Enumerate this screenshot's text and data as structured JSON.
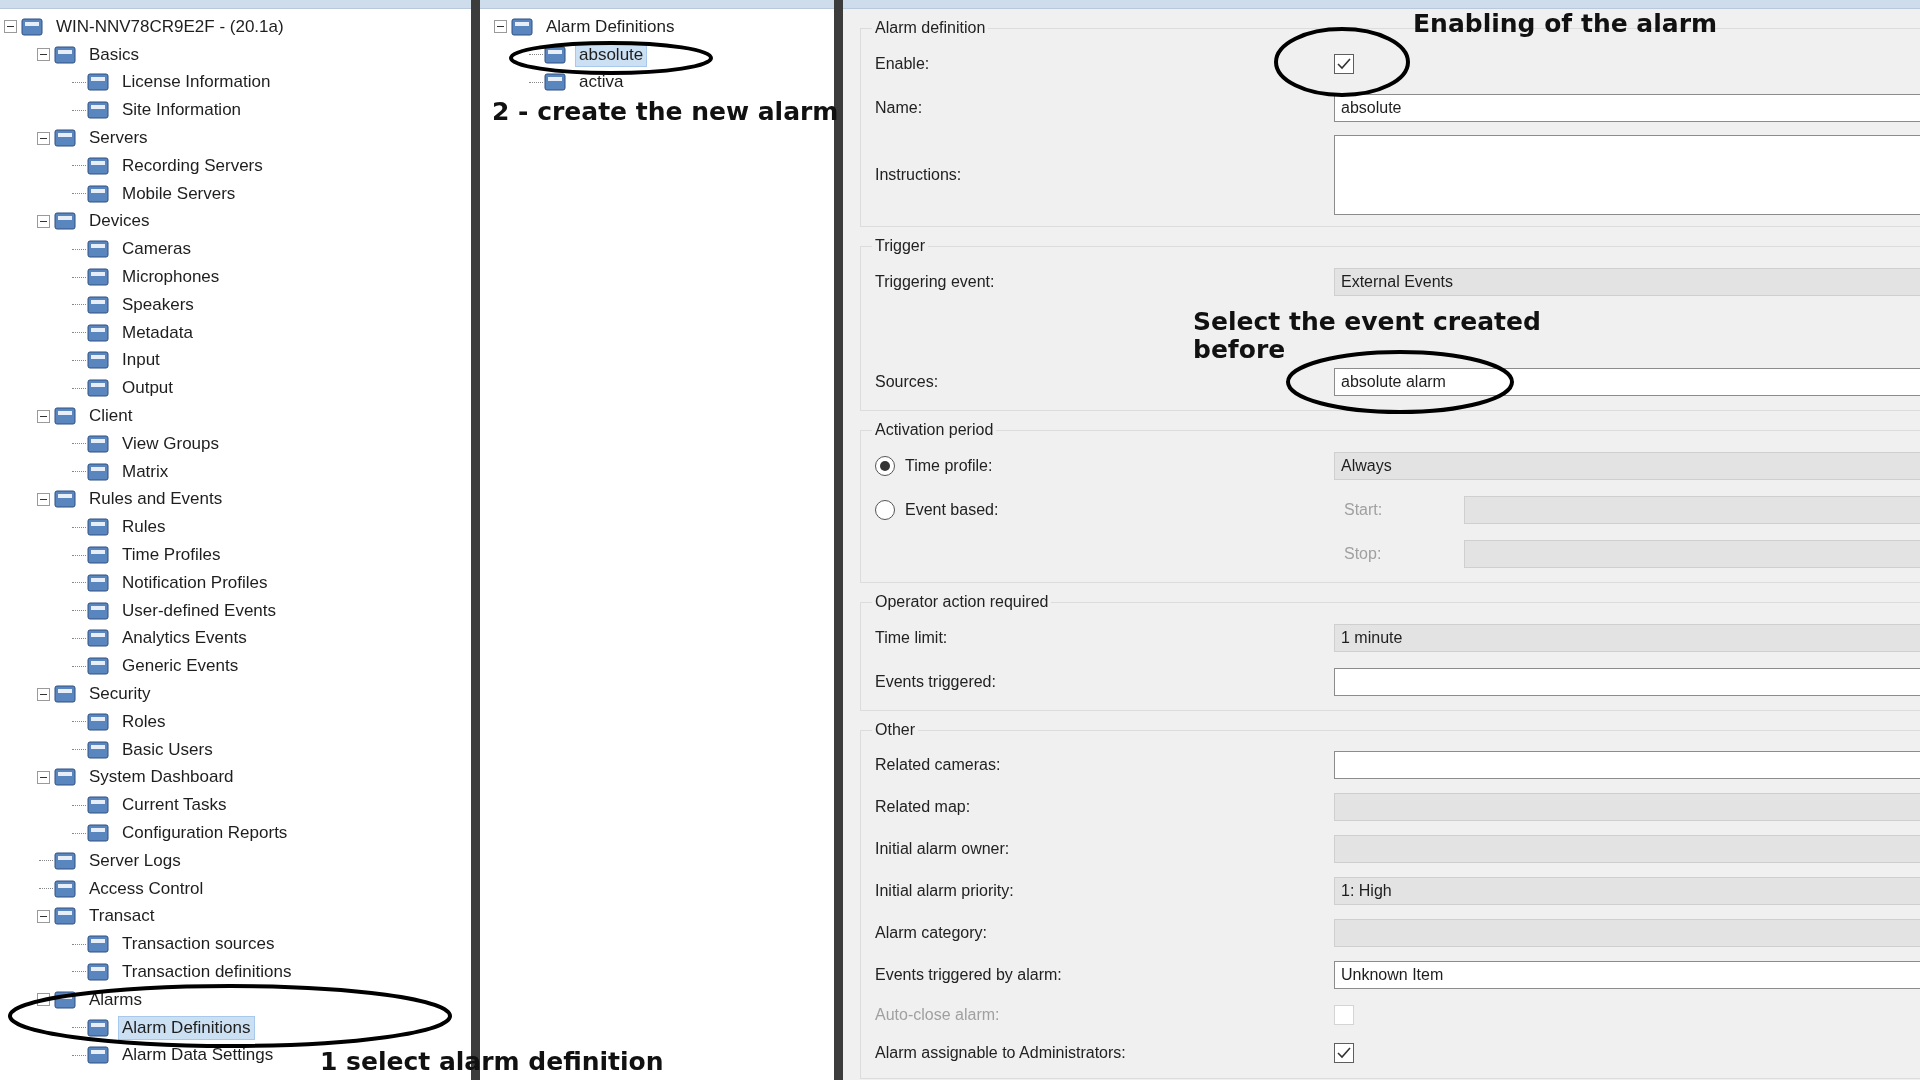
{
  "navigation": {
    "tree": [
      {
        "label": "WIN-NNV78CR9E2F - (20.1a)",
        "expanded": true,
        "selected": false,
        "children": [
          {
            "label": "Basics",
            "expanded": true,
            "selected": false,
            "children": [
              {
                "label": "License Information",
                "selected": false
              },
              {
                "label": "Site Information",
                "selected": false
              }
            ]
          },
          {
            "label": "Servers",
            "expanded": true,
            "selected": false,
            "children": [
              {
                "label": "Recording Servers",
                "selected": false
              },
              {
                "label": "Mobile Servers",
                "selected": false
              }
            ]
          },
          {
            "label": "Devices",
            "expanded": true,
            "selected": false,
            "children": [
              {
                "label": "Cameras",
                "selected": false
              },
              {
                "label": "Microphones",
                "selected": false
              },
              {
                "label": "Speakers",
                "selected": false
              },
              {
                "label": "Metadata",
                "selected": false
              },
              {
                "label": "Input",
                "selected": false
              },
              {
                "label": "Output",
                "selected": false
              }
            ]
          },
          {
            "label": "Client",
            "expanded": true,
            "selected": false,
            "children": [
              {
                "label": "View Groups",
                "selected": false
              },
              {
                "label": "Matrix",
                "selected": false
              }
            ]
          },
          {
            "label": "Rules and Events",
            "expanded": true,
            "selected": false,
            "children": [
              {
                "label": "Rules",
                "selected": false
              },
              {
                "label": "Time Profiles",
                "selected": false
              },
              {
                "label": "Notification Profiles",
                "selected": false
              },
              {
                "label": "User-defined Events",
                "selected": false
              },
              {
                "label": "Analytics Events",
                "selected": false
              },
              {
                "label": "Generic Events",
                "selected": false
              }
            ]
          },
          {
            "label": "Security",
            "expanded": true,
            "selected": false,
            "children": [
              {
                "label": "Roles",
                "selected": false
              },
              {
                "label": "Basic Users",
                "selected": false
              }
            ]
          },
          {
            "label": "System Dashboard",
            "expanded": true,
            "selected": false,
            "children": [
              {
                "label": "Current Tasks",
                "selected": false
              },
              {
                "label": "Configuration Reports",
                "selected": false
              }
            ]
          },
          {
            "label": "Server Logs",
            "selected": false
          },
          {
            "label": "Access Control",
            "selected": false
          },
          {
            "label": "Transact",
            "expanded": true,
            "selected": false,
            "children": [
              {
                "label": "Transaction sources",
                "selected": false
              },
              {
                "label": "Transaction definitions",
                "selected": false
              }
            ]
          },
          {
            "label": "Alarms",
            "expanded": true,
            "selected": false,
            "children": [
              {
                "label": "Alarm Definitions",
                "selected": true
              },
              {
                "label": "Alarm Data Settings",
                "selected": false
              }
            ]
          }
        ]
      }
    ]
  },
  "definitions": {
    "tree": [
      {
        "label": "Alarm Definitions",
        "expanded": true,
        "selected": false,
        "children": [
          {
            "label": "absolute",
            "selected": true
          },
          {
            "label": "activa",
            "selected": false
          }
        ]
      }
    ]
  },
  "details": {
    "sections": [
      {
        "legend": "Alarm definition",
        "rows": [
          {
            "kind": "checkbox",
            "label": "Enable:",
            "checked": true,
            "disabled": false
          },
          {
            "kind": "field",
            "label": "Name:",
            "value": "absolute"
          },
          {
            "kind": "textarea",
            "label": "Instructions:"
          }
        ]
      },
      {
        "legend": "Trigger",
        "rows": [
          {
            "kind": "combo",
            "label": "Triggering event:",
            "value": "External Events"
          },
          {
            "kind": "spacer"
          },
          {
            "kind": "field",
            "label": "Sources:",
            "value": "absolute alarm"
          }
        ]
      },
      {
        "legend": "Activation period",
        "rows": [
          {
            "kind": "radio",
            "label": "Time profile:",
            "selected": true,
            "value": "Always"
          },
          {
            "kind": "radio",
            "label": "Event based:",
            "selected": false,
            "sub": "Start:"
          },
          {
            "kind": "sub",
            "sub": "Stop:"
          }
        ]
      },
      {
        "legend": "Operator action required",
        "rows": [
          {
            "kind": "combo",
            "label": "Time limit:",
            "value": "1 minute"
          },
          {
            "kind": "field",
            "label": "Events triggered:"
          }
        ]
      },
      {
        "legend": "Other",
        "rows": [
          {
            "kind": "field",
            "label": "Related cameras:"
          },
          {
            "kind": "combo",
            "label": "Related map:"
          },
          {
            "kind": "combo",
            "label": "Initial alarm owner:"
          },
          {
            "kind": "combo",
            "label": "Initial alarm priority:",
            "value": "1: High"
          },
          {
            "kind": "combo",
            "label": "Alarm category:"
          },
          {
            "kind": "field",
            "label": "Events triggered by alarm:",
            "value": "Unknown Item"
          },
          {
            "kind": "checkbox",
            "label": "Auto-close alarm:",
            "checked": false,
            "disabled": true
          },
          {
            "kind": "checkbox",
            "label": "Alarm assignable to Administrators:",
            "checked": true,
            "disabled": false
          }
        ]
      }
    ]
  },
  "annotations": [
    {
      "text": "Enabling of the alarm"
    },
    {
      "text": "Select the event created before"
    },
    {
      "text": "2 - create the new alarm"
    },
    {
      "text": "1 select alarm definition"
    }
  ]
}
